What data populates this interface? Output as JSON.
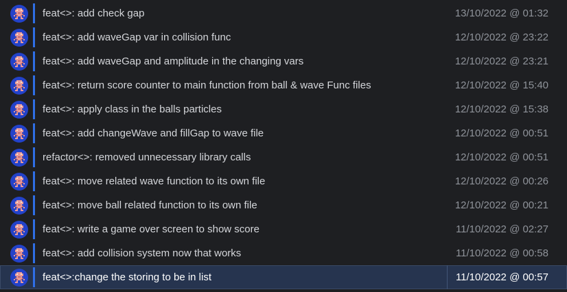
{
  "commits": [
    {
      "message": "feat<>: add check gap",
      "date": "13/10/2022 @ 01:32"
    },
    {
      "message": "feat<>: add waveGap var in collision func",
      "date": "12/10/2022 @ 23:22"
    },
    {
      "message": "feat<>: add waveGap and amplitude in the changing vars",
      "date": "12/10/2022 @ 23:21"
    },
    {
      "message": "feat<>: return score counter to main function from ball & wave Func files",
      "date": "12/10/2022 @ 15:40"
    },
    {
      "message": "feat<>: apply class in the balls particles",
      "date": "12/10/2022 @ 15:38"
    },
    {
      "message": "feat<>: add changeWave and fillGap to wave file",
      "date": "12/10/2022 @ 00:51"
    },
    {
      "message": "refactor<>: removed unnecessary library calls",
      "date": "12/10/2022 @ 00:51"
    },
    {
      "message": "feat<>: move related wave function to its own file",
      "date": "12/10/2022 @ 00:26"
    },
    {
      "message": "feat<>: move ball related function to its own file",
      "date": "12/10/2022 @ 00:21"
    },
    {
      "message": "feat<>: write a game over screen to show score",
      "date": "11/10/2022 @ 02:27"
    },
    {
      "message": "feat<>: add collision system now that works",
      "date": "11/10/2022 @ 00:58"
    },
    {
      "message": "feat<>:change the storing to be in list",
      "date": "11/10/2022 @ 00:57"
    }
  ],
  "selected_index": 11,
  "colors": {
    "background": "#1e1f22",
    "selected_row": "#26344f",
    "graph_line": "#2f6fe6",
    "avatar_bg": "#2342c9",
    "message_text": "#d4d6da",
    "date_text": "#8f939a"
  },
  "icons": {
    "avatar": "pixel-avatar-icon"
  }
}
